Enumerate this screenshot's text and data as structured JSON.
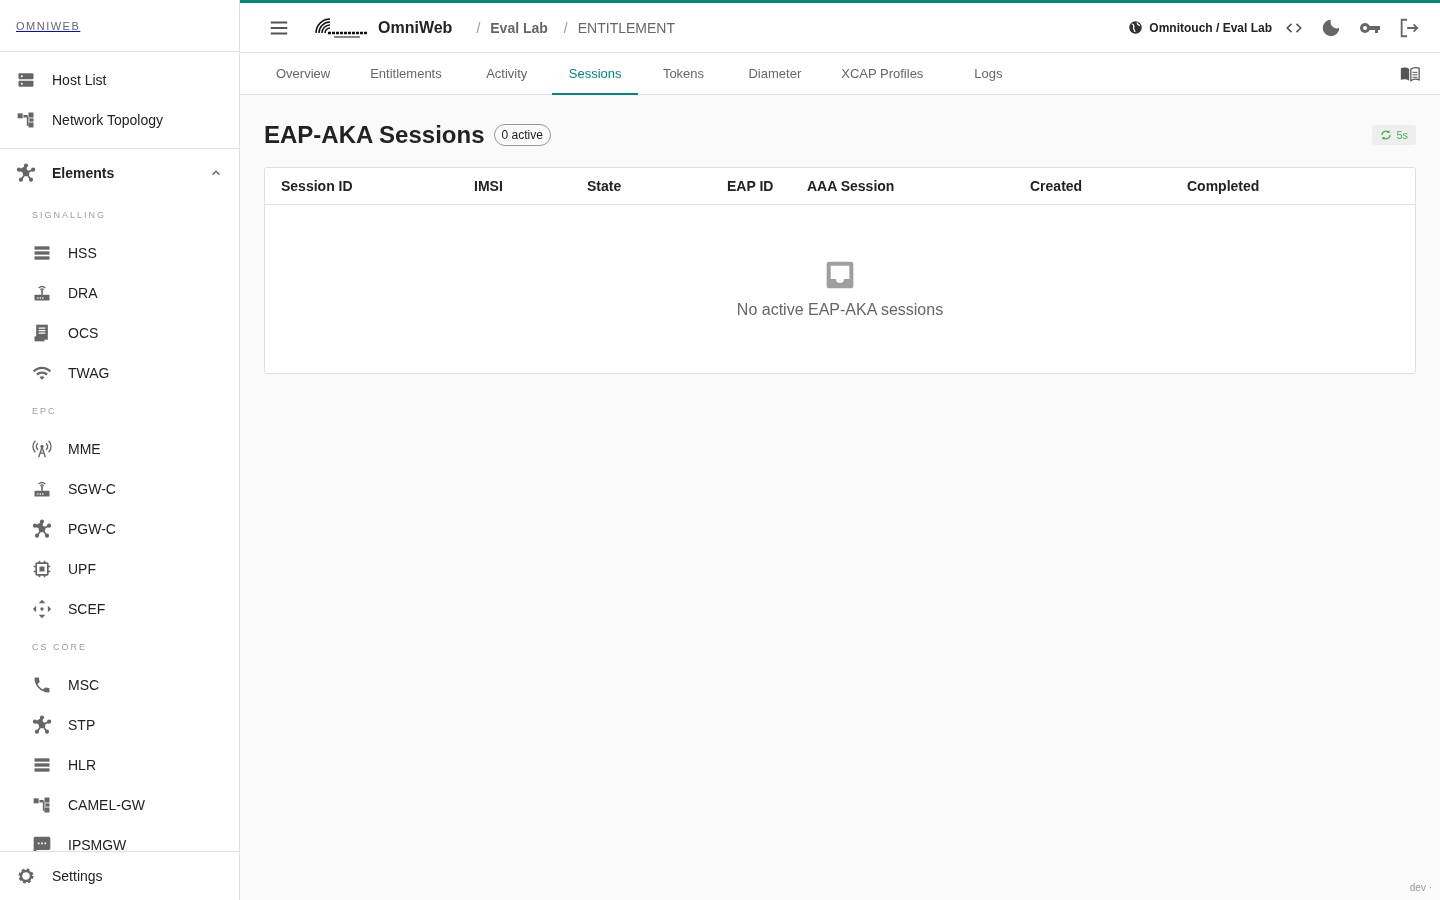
{
  "sidebar": {
    "brand": "OMNIWEB",
    "top_items": [
      {
        "label": "Host List",
        "selected": false
      },
      {
        "label": "Network Topology",
        "selected": false
      }
    ],
    "elements": {
      "label": "Elements",
      "expanded": true,
      "sections": [
        {
          "title": "SIGNALLING",
          "items": [
            "HSS",
            "DRA",
            "OCS",
            "TWAG"
          ]
        },
        {
          "title": "EPC",
          "items": [
            "MME",
            "SGW-C",
            "PGW-C",
            "UPF",
            "SCEF"
          ]
        },
        {
          "title": "CS CORE",
          "items": [
            "MSC",
            "STP",
            "HLR",
            "CAMEL-GW",
            "IPSMGW"
          ]
        }
      ]
    },
    "footer_item": "Settings"
  },
  "header": {
    "app_name": "OmniWeb",
    "breadcrumbs": [
      {
        "separator": "/",
        "label": "Eval Lab"
      },
      {
        "separator": "/",
        "label": "ENTITLEMENT"
      }
    ],
    "tenant": "Omnitouch / Eval Lab"
  },
  "tabs": [
    {
      "label": "Overview",
      "selected": false
    },
    {
      "label": "Entitlements",
      "selected": false
    },
    {
      "label": "Activity",
      "selected": false
    },
    {
      "label": "Sessions",
      "selected": true
    },
    {
      "label": "Tokens",
      "selected": false
    },
    {
      "label": "Diameter",
      "selected": false
    },
    {
      "label": "XCAP Profiles",
      "selected": false
    },
    {
      "label": "Logs",
      "selected": false
    }
  ],
  "page": {
    "title": "EAP-AKA Sessions",
    "badge": "0 active",
    "refresh": "5s"
  },
  "table": {
    "columns": [
      "Session ID",
      "IMSI",
      "State",
      "EAP ID",
      "AAA Session",
      "Created",
      "Completed"
    ],
    "empty_message": "No active EAP-AKA sessions"
  },
  "env_label": "dev ·"
}
